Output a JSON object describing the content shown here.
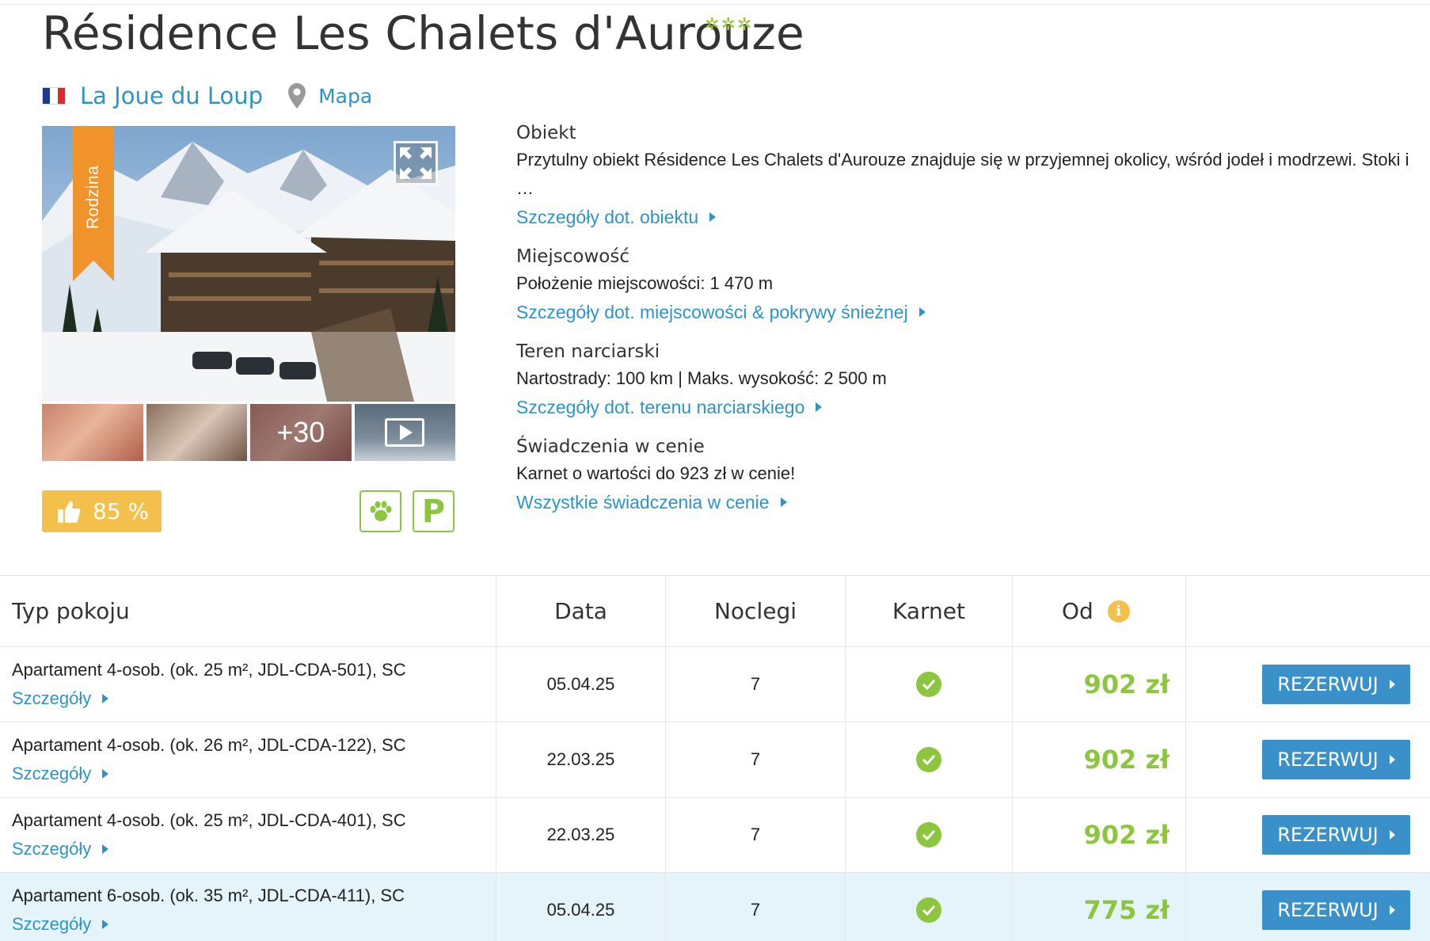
{
  "hotel": {
    "name": "Résidence Les Chalets d'Aurouze",
    "stars": 3,
    "location": "La Joue du Loup",
    "map_label": "Mapa",
    "ribbon_label": "Rodzina",
    "more_photos_label": "+30",
    "rating_label": "85 %",
    "amenity_icons": [
      "paw-icon",
      "parking-icon"
    ],
    "parking_label": "P"
  },
  "info": {
    "sections": [
      {
        "title": "Obiekt",
        "text": "Przytulny obiekt Résidence Les Chalets d'Aurouze znajduje się w przyjemnej okolicy, wśród jodeł i modrzewi. Stoki i …",
        "link": "Szczegóły dot. obiektu"
      },
      {
        "title": "Miejscowość",
        "text": "Położenie miejscowości: 1 470 m",
        "link": "Szczegóły dot. miejscowości & pokrywy śnieżnej"
      },
      {
        "title": "Teren narciarski",
        "text": "Nartostrady: 100 km | Maks. wysokość: 2 500 m",
        "link": "Szczegóły dot. terenu narciarskiego"
      },
      {
        "title": "Świadczenia w cenie",
        "text": "Karnet o wartości do 923 zł w cenie!",
        "link": "Wszystkie świadczenia w cenie"
      }
    ]
  },
  "table": {
    "headers": {
      "room": "Typ pokoju",
      "date": "Data",
      "nights": "Noclegi",
      "pass": "Karnet",
      "from": "Od"
    },
    "info_icon_glyph": "i",
    "rows": [
      {
        "room": "Apartament 4-osob. (ok. 25 m², JDL-CDA-501), SC",
        "details": "Szczegóły",
        "date": "05.04.25",
        "nights": "7",
        "pass_included": true,
        "price": "902 zł",
        "button": "REZERWUJ",
        "highlight": false
      },
      {
        "room": "Apartament 4-osob. (ok. 26 m², JDL-CDA-122), SC",
        "details": "Szczegóły",
        "date": "22.03.25",
        "nights": "7",
        "pass_included": true,
        "price": "902 zł",
        "button": "REZERWUJ",
        "highlight": false
      },
      {
        "room": "Apartament 4-osob. (ok. 25 m², JDL-CDA-401), SC",
        "details": "Szczegóły",
        "date": "22.03.25",
        "nights": "7",
        "pass_included": true,
        "price": "902 zł",
        "button": "REZERWUJ",
        "highlight": false
      },
      {
        "room": "Apartament 6-osob. (ok. 35 m², JDL-CDA-411), SC",
        "details": "Szczegóły",
        "date": "05.04.25",
        "nights": "7",
        "pass_included": true,
        "price": "775 zł",
        "button": "REZERWUJ",
        "highlight": true
      }
    ]
  },
  "colors": {
    "link": "#2e93c9",
    "price_green": "#8cc63f",
    "button_blue": "#3a90c8",
    "rating_yellow": "#f3c14b",
    "ribbon_orange": "#f0932a",
    "highlight_row": "#e5f3fa"
  }
}
